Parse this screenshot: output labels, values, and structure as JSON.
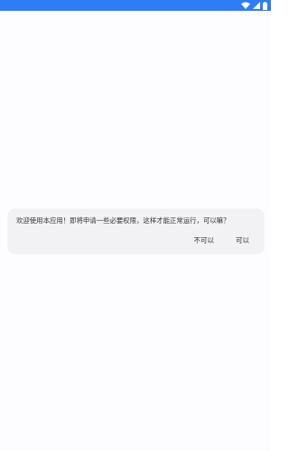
{
  "status_bar": {
    "color": "#2f7df6",
    "icons": [
      "wifi-icon",
      "signal-icon",
      "battery-icon"
    ]
  },
  "dialog": {
    "message": "欢迎使用本应用！即将申请一些必要权限，这样才能正常运行，可以嘛？",
    "negative_label": "不可以",
    "positive_label": "可以"
  }
}
